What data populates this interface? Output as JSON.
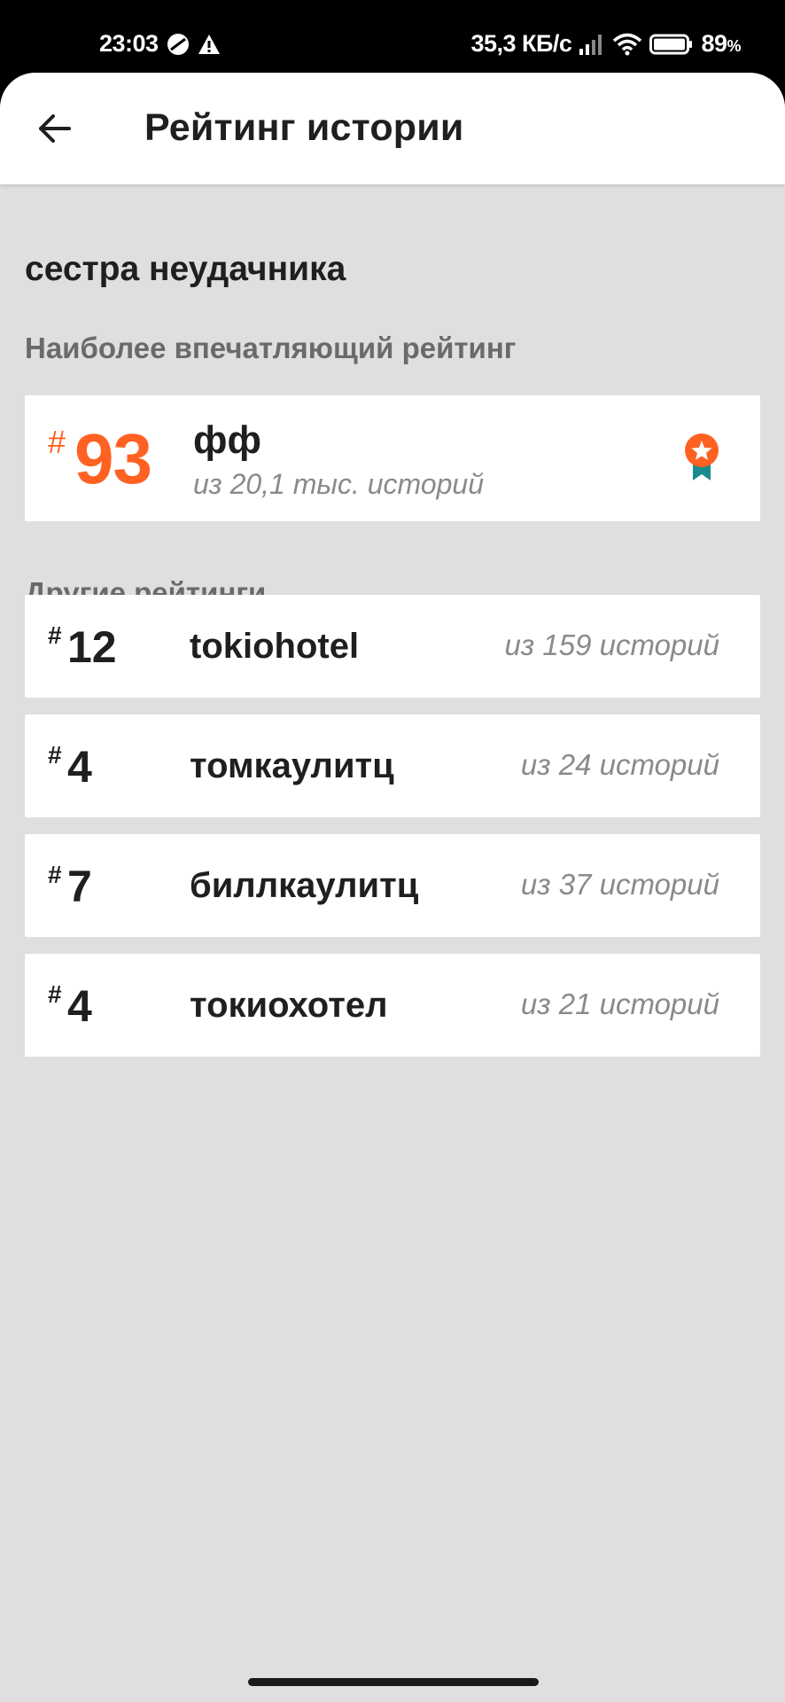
{
  "status_bar": {
    "time": "23:03",
    "network_speed": "35,3 КБ/с",
    "battery": "89",
    "battery_unit": "%"
  },
  "app_bar": {
    "title": "Рейтинг истории"
  },
  "story": {
    "title": "сестра неудачника"
  },
  "top_rating": {
    "section_label": "Наиболее впечатляющий рейтинг",
    "hash": "#",
    "rank": "93",
    "tag": "фф",
    "subtitle": "из 20,1 тыс. историй",
    "accent_color": "#ff6122"
  },
  "other_ratings": {
    "section_label": "Другие рейтинги",
    "items": [
      {
        "hash": "#",
        "rank": "12",
        "tag": "tokiohotel",
        "count": "из 159 историй"
      },
      {
        "hash": "#",
        "rank": "4",
        "tag": "томкаулитц",
        "count": "из 24 историй"
      },
      {
        "hash": "#",
        "rank": "7",
        "tag": "биллкаулитц",
        "count": "из 37 историй"
      },
      {
        "hash": "#",
        "rank": "4",
        "tag": "токиохотел",
        "count": "из 21 историй"
      }
    ]
  }
}
